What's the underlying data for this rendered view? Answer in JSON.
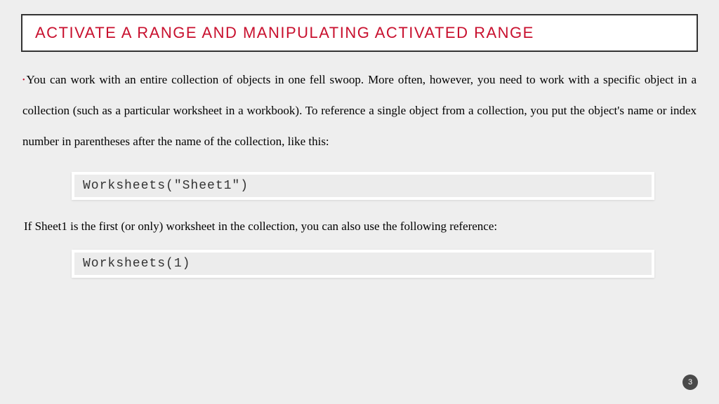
{
  "title": "ACTIVATE A RANGE AND MANIPULATING ACTIVATED RANGE",
  "paragraph1": "You can work with an entire collection of objects in one fell swoop. More often, however, you need to work with a specific object in a collection (such as a particular worksheet in a workbook). To reference a single object from a collection, you put the object's name or index number in parentheses after the name of the collection, like this:",
  "code1": "Worksheets(\"Sheet1\")",
  "paragraph2": "If Sheet1 is the first (or only) worksheet in the collection, you can also use the following reference:",
  "code2": "Worksheets(1)",
  "pageNumber": "3"
}
